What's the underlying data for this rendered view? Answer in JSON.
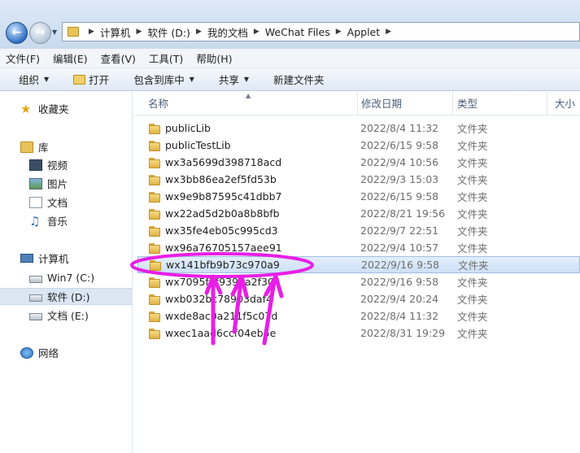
{
  "address": {
    "crumbs": [
      "计算机",
      "软件 (D:)",
      "我的文档",
      "WeChat Files",
      "Applet"
    ]
  },
  "menu": [
    "文件(F)",
    "编辑(E)",
    "查看(V)",
    "工具(T)",
    "帮助(H)"
  ],
  "commands": {
    "organize": "组织",
    "open": "打开",
    "include_library": "包含到库中",
    "share": "共享",
    "new_folder": "新建文件夹"
  },
  "nav": {
    "favorites": "收藏夹",
    "libraries": "库",
    "videos": "视频",
    "pictures": "图片",
    "documents": "文档",
    "music": "音乐",
    "computer": "计算机",
    "drive_c": "Win7 (C:)",
    "drive_d": "软件 (D:)",
    "drive_e": "文档 (E:)",
    "network": "网络"
  },
  "columns": {
    "name": "名称",
    "date": "修改日期",
    "type": "类型",
    "size": "大小"
  },
  "files": [
    {
      "name": "publicLib",
      "date": "2022/8/4 11:32",
      "type": "文件夹"
    },
    {
      "name": "publicTestLib",
      "date": "2022/6/15 9:58",
      "type": "文件夹"
    },
    {
      "name": "wx3a5699d398718acd",
      "date": "2022/9/4 10:56",
      "type": "文件夹"
    },
    {
      "name": "wx3bb86ea2ef5fd53b",
      "date": "2022/9/3 15:03",
      "type": "文件夹"
    },
    {
      "name": "wx9e9b87595c41dbb7",
      "date": "2022/6/15 9:58",
      "type": "文件夹"
    },
    {
      "name": "wx22ad5d2b0a8b8bfb",
      "date": "2022/8/21 19:56",
      "type": "文件夹"
    },
    {
      "name": "wx35fe4eb05c995cd3",
      "date": "2022/9/7 22:51",
      "type": "文件夹"
    },
    {
      "name": "wx96a76705157aee91",
      "date": "2022/9/4 10:57",
      "type": "文件夹"
    },
    {
      "name": "wx141bfb9b73c970a9",
      "date": "2022/9/16 9:58",
      "type": "文件夹"
    },
    {
      "name": "wx7095f7f9398a2f30",
      "date": "2022/9/16 9:58",
      "type": "文件夹"
    },
    {
      "name": "wxb032bc78903daf4",
      "date": "2022/9/4 20:24",
      "type": "文件夹"
    },
    {
      "name": "wxde8ac0a211f5c07d",
      "date": "2022/8/4 11:32",
      "type": "文件夹"
    },
    {
      "name": "wxec1aad6ccf04eb5e",
      "date": "2022/8/31 19:29",
      "type": "文件夹"
    }
  ],
  "selected_file_index": 8,
  "annotation_color": "#e81ee6"
}
